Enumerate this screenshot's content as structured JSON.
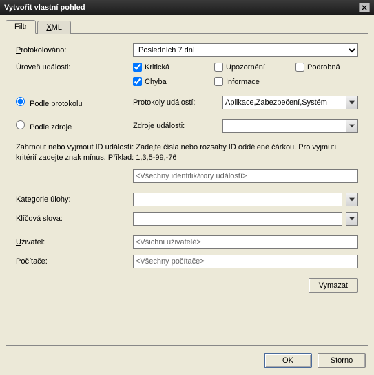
{
  "title": "Vytvořit vlastní pohled",
  "tabs": {
    "filter": "Filtr",
    "xml": "XML"
  },
  "labels": {
    "logged": "Protokolováno:",
    "level": "Úroveň události:",
    "by_log": "Podle protokolu",
    "by_source": "Podle zdroje",
    "event_logs": "Protokoly událostí:",
    "event_sources": "Zdroje události:",
    "help": "Zahrnout nebo vyjmout ID událostí: Zadejte čísla nebo rozsahy ID oddělené čárkou. Pro vyjmutí kritérií zadejte znak mínus. Příklad: 1,3,5-99,-76",
    "task_category": "Kategorie úlohy:",
    "keywords": "Klíčová slova:",
    "user": "Uživatel:",
    "computers": "Počítače:"
  },
  "values": {
    "logged": "Posledních 7 dní",
    "logs": "Aplikace,Zabezpečení,Systém",
    "sources": "",
    "event_ids": "<Všechny identifikátory událostí>",
    "task_category": "",
    "keywords": "",
    "user": "<Všichni uživatelé>",
    "computers": "<Všechny počítače>"
  },
  "checkboxes": {
    "critical": "Kritická",
    "warning": "Upozornění",
    "verbose": "Podrobná",
    "error": "Chyba",
    "information": "Informace"
  },
  "buttons": {
    "clear": "Vymazat",
    "ok": "OK",
    "cancel": "Storno"
  }
}
